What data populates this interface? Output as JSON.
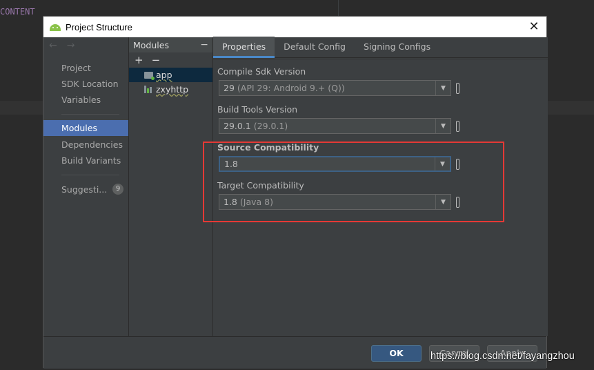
{
  "background": {
    "editor_text": "CONTENT"
  },
  "dialog": {
    "title": "Project Structure",
    "close_glyph": "✕",
    "nav": {
      "back_glyph": "←",
      "forward_glyph": "→",
      "group1": [
        "Project",
        "SDK Location",
        "Variables"
      ],
      "selected": "Modules",
      "group2": [
        "Dependencies",
        "Build Variants"
      ],
      "suggestions_label": "Suggesti...",
      "suggestions_count": "9"
    },
    "modules": {
      "header": "Modules",
      "collapse_glyph": "−",
      "add_glyph": "+",
      "remove_glyph": "−",
      "items": [
        {
          "label": "app",
          "icon": "module-folder-icon",
          "selected": true
        },
        {
          "label": "zxyhttp",
          "icon": "library-module-icon",
          "selected": false
        }
      ]
    },
    "tabs": [
      "Properties",
      "Default Config",
      "Signing Configs"
    ],
    "active_tab": "Properties",
    "fields": [
      {
        "label": "Compile Sdk Version",
        "value": "29",
        "hint": "(API 29: Android 9.+ (Q))"
      },
      {
        "label": "Build Tools Version",
        "value": "29.0.1",
        "hint": "(29.0.1)"
      },
      {
        "label": "Source Compatibility",
        "value": "1.8",
        "hint": ""
      },
      {
        "label": "Target Compatibility",
        "value": "1.8",
        "hint": "(Java 8)"
      }
    ],
    "buttons": {
      "ok": "OK",
      "cancel": "Cancel",
      "apply": "Apply"
    }
  },
  "watermark": "https://blog.csdn.net/fayangzhou",
  "colors": {
    "selection": "#4b6eaf",
    "highlight_box": "#e53935",
    "ok_button": "#365880"
  }
}
